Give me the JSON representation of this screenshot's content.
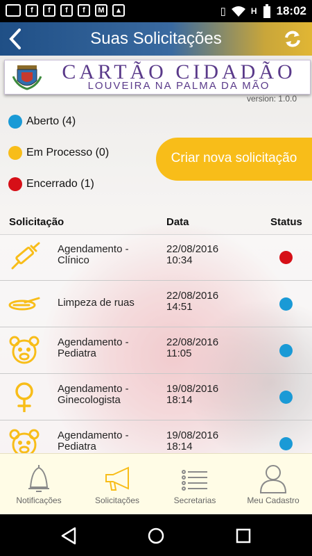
{
  "status_bar": {
    "time": "18:02",
    "left_icons": [
      "keyboard-icon",
      "facebook-icon",
      "facebook-icon",
      "facebook-icon",
      "facebook-icon",
      "gmail-icon",
      "image-icon"
    ],
    "right_icons": [
      "vibrate-icon",
      "wifi-icon",
      "h-signal-icon",
      "battery-icon"
    ],
    "network_label": "H"
  },
  "header": {
    "title": "Suas Solicitações"
  },
  "banner": {
    "main": "CARTÃO CIDADÃO",
    "sub": "LOUVEIRA NA PALMA DA MÃO"
  },
  "version": "version: 1.0.0",
  "legend": [
    {
      "label": "Aberto (4)",
      "color": "#1a9ad6"
    },
    {
      "label": "Em Processo (0)",
      "color": "#f8bd19"
    },
    {
      "label": "Encerrado (1)",
      "color": "#d60f17"
    }
  ],
  "create_button": "Criar nova solicitação",
  "table": {
    "headers": {
      "solicitacao": "Solicitação",
      "data": "Data",
      "status": "Status"
    },
    "rows": [
      {
        "icon": "syringe-icon",
        "name": "Agendamento - Clínico",
        "date": "22/08/2016 10:34",
        "status_color": "#d60f17"
      },
      {
        "icon": "broom-icon",
        "name": "Limpeza de ruas",
        "date": "22/08/2016 14:51",
        "status_color": "#1a9ad6"
      },
      {
        "icon": "bear-icon",
        "name": "Agendamento - Pediatra",
        "date": "22/08/2016 11:05",
        "status_color": "#1a9ad6"
      },
      {
        "icon": "female-symbol-icon",
        "name": "Agendamento - Ginecologista",
        "date": "19/08/2016 18:14",
        "status_color": "#1a9ad6"
      },
      {
        "icon": "bear-icon",
        "name": "Agendamento - Pediatra",
        "date": "19/08/2016 18:14",
        "status_color": "#1a9ad6"
      }
    ]
  },
  "bottom_nav": [
    {
      "label": "Notificações",
      "icon": "bell-icon"
    },
    {
      "label": "Solicitações",
      "icon": "megaphone-icon"
    },
    {
      "label": "Secretarias",
      "icon": "list-icon"
    },
    {
      "label": "Meu Cadastro",
      "icon": "user-icon"
    }
  ]
}
